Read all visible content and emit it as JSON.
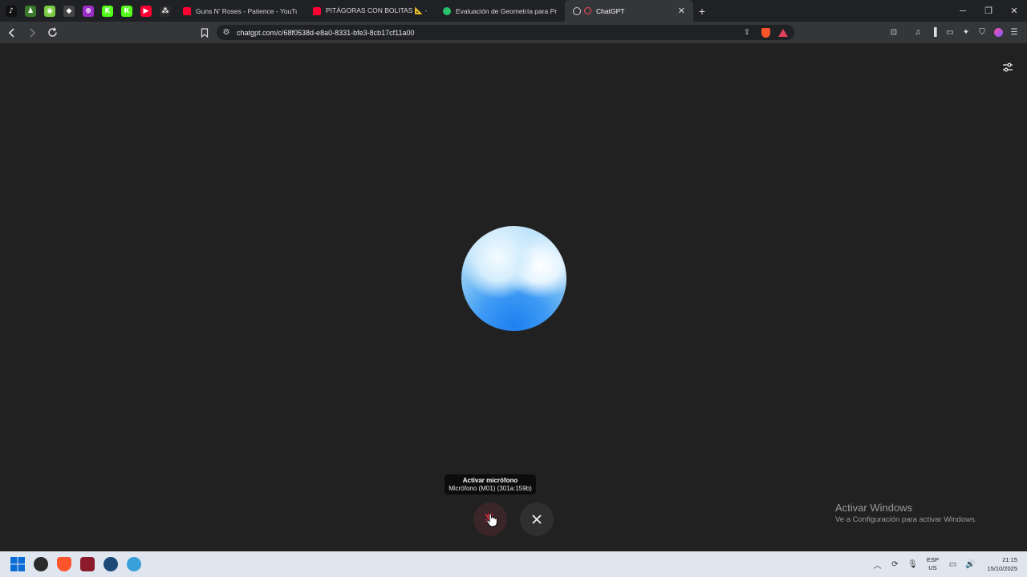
{
  "browser": {
    "pinned_tabs": [
      {
        "name": "tiktok-tab",
        "color": "#111111",
        "glyph": "♪"
      },
      {
        "name": "app-tab-2",
        "color": "#3b7a2a",
        "glyph": "♟"
      },
      {
        "name": "app-tab-3",
        "color": "#7ac943",
        "glyph": "◉"
      },
      {
        "name": "app-tab-4",
        "color": "#444444",
        "glyph": "◆"
      },
      {
        "name": "app-tab-5",
        "color": "#9b2ec7",
        "glyph": "⊕"
      },
      {
        "name": "kick-tab-1",
        "color": "#53fc18",
        "glyph": "K"
      },
      {
        "name": "kick-tab-2",
        "color": "#53fc18",
        "glyph": "K"
      },
      {
        "name": "youtube-pinned-tab",
        "color": "#ff0033",
        "glyph": "▶"
      },
      {
        "name": "app-tab-9",
        "color": "#2a2a2a",
        "glyph": "⁂"
      }
    ],
    "tabs": [
      {
        "label": "Guns N' Roses - Patience - YouTube",
        "fav_color": "#ff0033"
      },
      {
        "label": "PITÁGORAS CON BOLITAS 📐 - YouT",
        "fav_color": "#ff0033"
      },
      {
        "label": "Evaluación de Geometría para Primer",
        "fav_color": "#27c26b"
      },
      {
        "label": "ChatGPT",
        "fav_color": "#d0d0d0",
        "active": true
      }
    ],
    "new_tab": "+",
    "url": "chatgpt.com/c/68f0538d-e8a0-8331-bfe3-8cb17cf11a00"
  },
  "tooltip": {
    "title": "Activar micrófono",
    "subtitle": "Micrófono (M01) (301a:159b)"
  },
  "watermark": {
    "title": "Activar Windows",
    "subtitle": "Ve a Configuración para activar Windows."
  },
  "tray": {
    "lang_top": "ESP",
    "lang_bottom": "US",
    "time": "21:15",
    "date": "15/10/2025"
  },
  "colors": {
    "background": "#212121",
    "tab_strip": "#202124",
    "toolbar": "#35363a",
    "taskbar": "#dfe6ef",
    "mic_muted": "#e02e3e"
  }
}
